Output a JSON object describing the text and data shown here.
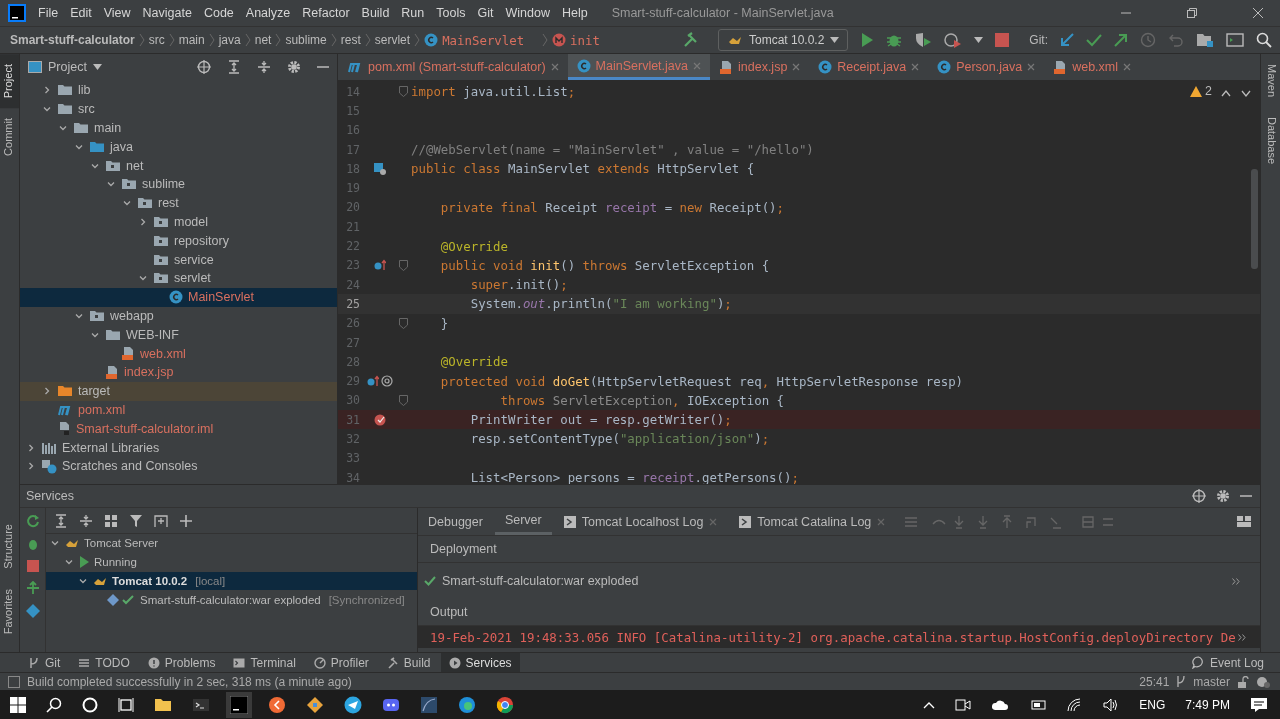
{
  "window": {
    "title": "Smart-stuff-calculator - MainServlet.java"
  },
  "menu": [
    "File",
    "Edit",
    "View",
    "Navigate",
    "Code",
    "Analyze",
    "Refactor",
    "Build",
    "Run",
    "Tools",
    "Git",
    "Window",
    "Help"
  ],
  "breadcrumbs": [
    {
      "label": "Smart-stuff-calculator",
      "kind": "project"
    },
    {
      "label": "src",
      "kind": "folder"
    },
    {
      "label": "main",
      "kind": "folder"
    },
    {
      "label": "java",
      "kind": "folder"
    },
    {
      "label": "net",
      "kind": "folder"
    },
    {
      "label": "sublime",
      "kind": "folder"
    },
    {
      "label": "rest",
      "kind": "folder"
    },
    {
      "label": "servlet",
      "kind": "folder"
    },
    {
      "label": "MainServlet",
      "kind": "class"
    },
    {
      "label": "init",
      "kind": "method"
    }
  ],
  "toolbar": {
    "run_configuration": "Tomcat 10.0.2",
    "git_label": "Git:"
  },
  "project_panel": {
    "title": "Project",
    "project_items": [
      {
        "label": "lib",
        "kind": "folder",
        "expanded": false,
        "selected": false,
        "untracked": false,
        "excluded": false
      },
      {
        "label": "src",
        "kind": "folder",
        "expanded": true,
        "selected": false,
        "untracked": false,
        "excluded": false,
        "children": [
          {
            "label": "main",
            "kind": "folder",
            "expanded": true,
            "selected": false,
            "untracked": false,
            "excluded": false,
            "children": [
              {
                "label": "java",
                "kind": "source",
                "expanded": true,
                "selected": false,
                "untracked": false,
                "excluded": false,
                "children": [
                  {
                    "label": "net",
                    "kind": "package",
                    "expanded": true,
                    "selected": false,
                    "untracked": false,
                    "excluded": false,
                    "children": [
                      {
                        "label": "sublime",
                        "kind": "package",
                        "expanded": true,
                        "selected": false,
                        "untracked": false,
                        "excluded": false,
                        "children": [
                          {
                            "label": "rest",
                            "kind": "package",
                            "expanded": true,
                            "selected": false,
                            "untracked": false,
                            "excluded": false,
                            "children": [
                              {
                                "label": "model",
                                "kind": "package",
                                "expanded": false,
                                "selected": false,
                                "untracked": false,
                                "excluded": false
                              },
                              {
                                "label": "repository",
                                "kind": "package",
                                "selected": false,
                                "untracked": false,
                                "excluded": false
                              },
                              {
                                "label": "service",
                                "kind": "package",
                                "selected": false,
                                "untracked": false,
                                "excluded": false
                              },
                              {
                                "label": "servlet",
                                "kind": "package",
                                "expanded": true,
                                "selected": false,
                                "untracked": false,
                                "excluded": false,
                                "children": [
                                  {
                                    "label": "MainServlet",
                                    "kind": "class",
                                    "selected": true,
                                    "untracked": true,
                                    "excluded": false
                                  }
                                ]
                              }
                            ]
                          }
                        ]
                      }
                    ]
                  }
                ]
              },
              {
                "label": "webapp",
                "kind": "web",
                "expanded": true,
                "selected": false,
                "untracked": false,
                "excluded": false,
                "children": [
                  {
                    "label": "WEB-INF",
                    "kind": "folder",
                    "expanded": true,
                    "selected": false,
                    "untracked": false,
                    "excluded": false,
                    "children": [
                      {
                        "label": "web.xml",
                        "kind": "xml",
                        "selected": false,
                        "untracked": true,
                        "excluded": false
                      }
                    ]
                  },
                  {
                    "label": "index.jsp",
                    "kind": "jsp",
                    "selected": false,
                    "untracked": true,
                    "excluded": false
                  }
                ]
              }
            ]
          }
        ]
      },
      {
        "label": "target",
        "kind": "excluded",
        "expanded": false,
        "selected": false,
        "untracked": false,
        "excluded": true
      },
      {
        "label": "pom.xml",
        "kind": "maven",
        "selected": false,
        "untracked": true,
        "excluded": false
      },
      {
        "label": "Smart-stuff-calculator.iml",
        "kind": "iml",
        "selected": false,
        "untracked": true,
        "excluded": false
      }
    ],
    "other_items": [
      {
        "label": "External Libraries",
        "kind": "libraries",
        "expanded": false,
        "selected": false,
        "untracked": false,
        "excluded": false
      },
      {
        "label": "Scratches and Consoles",
        "kind": "scratches",
        "expanded": false,
        "selected": false,
        "untracked": false,
        "excluded": false
      }
    ]
  },
  "editor_tabs": [
    {
      "label": "pom.xml (Smart-stuff-calculator)",
      "kind": "maven",
      "selected": false
    },
    {
      "label": "MainServlet.java",
      "kind": "class",
      "selected": true
    },
    {
      "label": "index.jsp",
      "kind": "jsp",
      "selected": false
    },
    {
      "label": "Receipt.java",
      "kind": "class",
      "selected": false
    },
    {
      "label": "Person.java",
      "kind": "class",
      "selected": false
    },
    {
      "label": "web.xml",
      "kind": "xml",
      "selected": false
    }
  ],
  "editor": {
    "warnings": "2",
    "lines": [
      {
        "number": "14",
        "current": false,
        "breakpoint": false,
        "fold": true,
        "tokens": [
          {
            "t": "import",
            "kind": "kw"
          },
          {
            "t": " java.util.List",
            "kind": "plain"
          },
          {
            "t": ";",
            "kind": "kw"
          }
        ]
      },
      {
        "number": "15",
        "current": false,
        "breakpoint": false,
        "fold": false
      },
      {
        "number": "16",
        "current": false,
        "breakpoint": false,
        "fold": false
      },
      {
        "number": "17",
        "current": false,
        "breakpoint": false,
        "fold": false,
        "tokens": [
          {
            "t": "//@WebServlet(name = \"MainServlet\" , value = \"/hello\")",
            "kind": "com"
          }
        ]
      },
      {
        "number": "18",
        "current": false,
        "breakpoint": false,
        "fold": false,
        "gutter": [
          {
            "kind": "servlet"
          }
        ],
        "tokens": [
          {
            "t": "public class ",
            "kind": "kw"
          },
          {
            "t": "MainServlet ",
            "kind": "plain"
          },
          {
            "t": "extends ",
            "kind": "kw"
          },
          {
            "t": "HttpServlet {",
            "kind": "plain"
          }
        ]
      },
      {
        "number": "19",
        "current": false,
        "breakpoint": false,
        "fold": false
      },
      {
        "number": "20",
        "current": false,
        "breakpoint": false,
        "fold": false,
        "tokens": [
          {
            "t": "    private final ",
            "kind": "kw"
          },
          {
            "t": "Receipt ",
            "kind": "plain"
          },
          {
            "t": "receipt",
            "kind": "field"
          },
          {
            "t": " = ",
            "kind": "plain"
          },
          {
            "t": "new ",
            "kind": "kw"
          },
          {
            "t": "Receipt()",
            "kind": "plain"
          },
          {
            "t": ";",
            "kind": "kw"
          }
        ]
      },
      {
        "number": "21",
        "current": false,
        "breakpoint": false,
        "fold": false
      },
      {
        "number": "22",
        "current": false,
        "breakpoint": false,
        "fold": false,
        "tokens": [
          {
            "t": "    @Override",
            "kind": "ann"
          }
        ]
      },
      {
        "number": "23",
        "current": false,
        "breakpoint": false,
        "fold": true,
        "gutter": [
          {
            "kind": "override"
          }
        ],
        "tokens": [
          {
            "t": "    public void ",
            "kind": "kw"
          },
          {
            "t": "init",
            "kind": "fn"
          },
          {
            "t": "() ",
            "kind": "plain"
          },
          {
            "t": "throws ",
            "kind": "kw"
          },
          {
            "t": "ServletException {",
            "kind": "plain"
          }
        ]
      },
      {
        "number": "24",
        "current": false,
        "breakpoint": false,
        "fold": false,
        "tokens": [
          {
            "t": "        super",
            "kind": "kw"
          },
          {
            "t": ".init()",
            "kind": "plain"
          },
          {
            "t": ";",
            "kind": "kw"
          }
        ]
      },
      {
        "number": "25",
        "current": true,
        "breakpoint": false,
        "fold": false,
        "tokens": [
          {
            "t": "        System.",
            "kind": "plain"
          },
          {
            "t": "out",
            "kind": "sfield"
          },
          {
            "t": ".println(",
            "kind": "plain"
          },
          {
            "t": "\"I am working\"",
            "kind": "str"
          },
          {
            "t": ")",
            "kind": "plain"
          },
          {
            "t": ";",
            "kind": "kw"
          }
        ]
      },
      {
        "number": "26",
        "current": false,
        "breakpoint": false,
        "fold": true,
        "tokens": [
          {
            "t": "    }",
            "kind": "plain"
          }
        ]
      },
      {
        "number": "27",
        "current": false,
        "breakpoint": false,
        "fold": false
      },
      {
        "number": "28",
        "current": false,
        "breakpoint": false,
        "fold": false,
        "tokens": [
          {
            "t": "    @Override",
            "kind": "ann"
          }
        ]
      },
      {
        "number": "29",
        "current": false,
        "breakpoint": false,
        "fold": false,
        "gutter": [
          {
            "kind": "override"
          },
          {
            "kind": "mapping"
          }
        ],
        "tokens": [
          {
            "t": "    protected void ",
            "kind": "kw"
          },
          {
            "t": "doGet",
            "kind": "fn"
          },
          {
            "t": "(HttpServletRequest req",
            "kind": "plain"
          },
          {
            "t": ", ",
            "kind": "kw"
          },
          {
            "t": "HttpServletResponse resp)",
            "kind": "plain"
          }
        ]
      },
      {
        "number": "30",
        "current": false,
        "breakpoint": false,
        "fold": true,
        "tokens": [
          {
            "t": "            throws ",
            "kind": "kw"
          },
          {
            "t": "ServletException",
            "kind": "dim"
          },
          {
            "t": ", ",
            "kind": "kw"
          },
          {
            "t": "IOException {",
            "kind": "plain"
          }
        ]
      },
      {
        "number": "31",
        "current": false,
        "breakpoint": true,
        "fold": false,
        "tokens": [
          {
            "t": "        PrintWriter out = resp.getWriter()",
            "kind": "plain"
          },
          {
            "t": ";",
            "kind": "kw"
          }
        ]
      },
      {
        "number": "32",
        "current": false,
        "breakpoint": false,
        "fold": false,
        "tokens": [
          {
            "t": "        resp.setContentType(",
            "kind": "plain"
          },
          {
            "t": "\"application/json\"",
            "kind": "str"
          },
          {
            "t": ")",
            "kind": "plain"
          },
          {
            "t": ";",
            "kind": "kw"
          }
        ]
      },
      {
        "number": "33",
        "current": false,
        "breakpoint": false,
        "fold": false
      },
      {
        "number": "34",
        "current": false,
        "breakpoint": false,
        "fold": false,
        "tokens": [
          {
            "t": "        List<Person> persons = ",
            "kind": "plain"
          },
          {
            "t": "receipt",
            "kind": "field"
          },
          {
            "t": ".getPersons()",
            "kind": "plain"
          },
          {
            "t": ";",
            "kind": "kw"
          }
        ]
      }
    ]
  },
  "side_tabs_left": [
    {
      "label": "Project",
      "selected": true
    },
    {
      "label": "Commit",
      "selected": false
    }
  ],
  "side_tabs_left_bottom": [
    {
      "label": "Structure",
      "selected": false
    },
    {
      "label": "Favorites",
      "selected": false
    }
  ],
  "side_tabs_right": [
    {
      "label": "Maven",
      "selected": false
    },
    {
      "label": "Database",
      "selected": false
    }
  ],
  "services": {
    "title": "Services",
    "tree": [
      {
        "label": "Tomcat Server",
        "kind": "tomcat",
        "expanded": true,
        "selected": false,
        "children": [
          {
            "label": "Running",
            "kind": "running",
            "expanded": true,
            "selected": false,
            "children": [
              {
                "label": "Tomcat 10.0.2",
                "suffix": "[local]",
                "kind": "tomcat",
                "expanded": true,
                "selected": true,
                "children": [
                  {
                    "label": "Smart-stuff-calculator:war exploded",
                    "suffix": "[Synchronized]",
                    "kind": "artifact",
                    "selected": false
                  }
                ]
              }
            ]
          }
        ]
      }
    ],
    "tabs": [
      {
        "label": "Debugger",
        "kind": "plain",
        "selected": false
      },
      {
        "label": "Server",
        "kind": "plain",
        "selected": true
      },
      {
        "label": "Tomcat Localhost Log",
        "kind": "log",
        "selected": false
      },
      {
        "label": "Tomcat Catalina Log",
        "kind": "log",
        "selected": false
      }
    ],
    "deployment_heading": "Deployment",
    "deployment": "Smart-stuff-calculator:war exploded",
    "output_heading": "Output",
    "output": "19-Feb-2021 19:48:33.056 INFO [Catalina-utility-2] org.apache.catalina.startup.HostConfig.deployDirectory De"
  },
  "tool_tabs": [
    {
      "label": "Git",
      "kind": "git",
      "selected": false
    },
    {
      "label": "TODO",
      "kind": "todo",
      "selected": false
    },
    {
      "label": "Problems",
      "kind": "problems",
      "selected": false
    },
    {
      "label": "Terminal",
      "kind": "terminal",
      "selected": false
    },
    {
      "label": "Profiler",
      "kind": "profiler",
      "selected": false
    },
    {
      "label": "Build",
      "kind": "build",
      "selected": false
    },
    {
      "label": "Services",
      "kind": "services",
      "selected": true
    }
  ],
  "event_log": "Event Log",
  "status_bar": {
    "message": "Build completed successfully in 2 sec, 318 ms (a minute ago)",
    "position": "25:41",
    "branch": "master"
  },
  "taskbar": {
    "language": "ENG",
    "time": "7:49 PM"
  }
}
